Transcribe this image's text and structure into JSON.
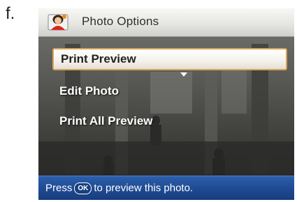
{
  "figure": {
    "label": "f."
  },
  "header": {
    "title": "Photo Options",
    "icon": "person-photo-icon"
  },
  "menu": {
    "items": [
      {
        "label": "Print Preview",
        "selected": true
      },
      {
        "label": "Edit Photo",
        "selected": false
      },
      {
        "label": "Print All Preview",
        "selected": false
      }
    ]
  },
  "footer": {
    "prefix": "Press",
    "ok_key": "OK",
    "suffix": "to preview this photo."
  },
  "colors": {
    "title_bar": "#e6e6e2",
    "status_bar": "#1f4b93",
    "selection_border": "#d7a55a",
    "menu_text": "#ffffff"
  }
}
